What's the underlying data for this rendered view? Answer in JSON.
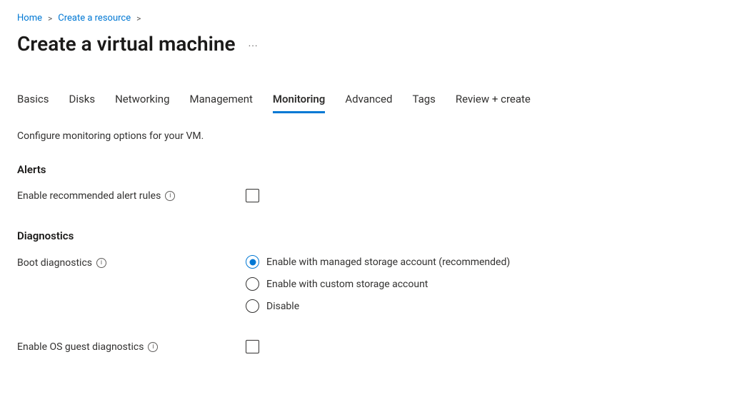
{
  "breadcrumb": {
    "items": [
      {
        "label": "Home"
      },
      {
        "label": "Create a resource"
      }
    ]
  },
  "page": {
    "title": "Create a virtual machine",
    "more": "···"
  },
  "tabs": [
    {
      "label": "Basics",
      "active": false
    },
    {
      "label": "Disks",
      "active": false
    },
    {
      "label": "Networking",
      "active": false
    },
    {
      "label": "Management",
      "active": false
    },
    {
      "label": "Monitoring",
      "active": true
    },
    {
      "label": "Advanced",
      "active": false
    },
    {
      "label": "Tags",
      "active": false
    },
    {
      "label": "Review + create",
      "active": false
    }
  ],
  "description": "Configure monitoring options for your VM.",
  "sections": {
    "alerts": {
      "heading": "Alerts",
      "enable_recommended_label": "Enable recommended alert rules",
      "enable_recommended_checked": false
    },
    "diagnostics": {
      "heading": "Diagnostics",
      "boot_label": "Boot diagnostics",
      "boot_options": [
        {
          "label": "Enable with managed storage account (recommended)",
          "selected": true
        },
        {
          "label": "Enable with custom storage account",
          "selected": false
        },
        {
          "label": "Disable",
          "selected": false
        }
      ],
      "guest_label": "Enable OS guest diagnostics",
      "guest_checked": false
    }
  }
}
